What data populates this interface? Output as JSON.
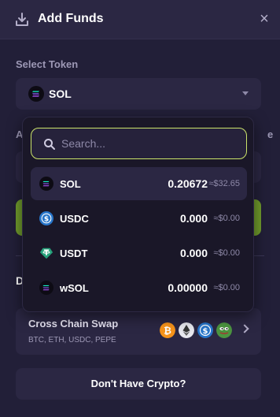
{
  "header": {
    "title": "Add Funds",
    "close_symbol": "×"
  },
  "select_token": {
    "label": "Select Token",
    "selected": "SOL"
  },
  "background_fragments": {
    "amount_initial": "A",
    "right_initial": "e",
    "section_initial": "D"
  },
  "search": {
    "placeholder": "Search...",
    "value": ""
  },
  "tokens": [
    {
      "name": "SOL",
      "amount": "0.20672",
      "usd": "≈$32.65",
      "icon": "solana-icon"
    },
    {
      "name": "USDC",
      "amount": "0.000",
      "usd": "≈$0.00",
      "icon": "usdc-icon"
    },
    {
      "name": "USDT",
      "amount": "0.000",
      "usd": "≈$0.00",
      "icon": "usdt-icon"
    },
    {
      "name": "wSOL",
      "amount": "0.00000",
      "usd": "≈$0.00",
      "icon": "wsol-icon"
    }
  ],
  "cross_chain": {
    "title": "Cross Chain Swap",
    "subtitle": "BTC, ETH, USDC, PEPE"
  },
  "no_crypto_button": "Don't Have Crypto?",
  "colors": {
    "background": "#221f38",
    "accent_green": "#6f9a2c",
    "search_border": "#cbe46a",
    "usdc_blue": "#2775ca",
    "usdt_teal": "#26a17b",
    "btc_orange": "#f7931a",
    "pepe_green": "#4c9540"
  }
}
